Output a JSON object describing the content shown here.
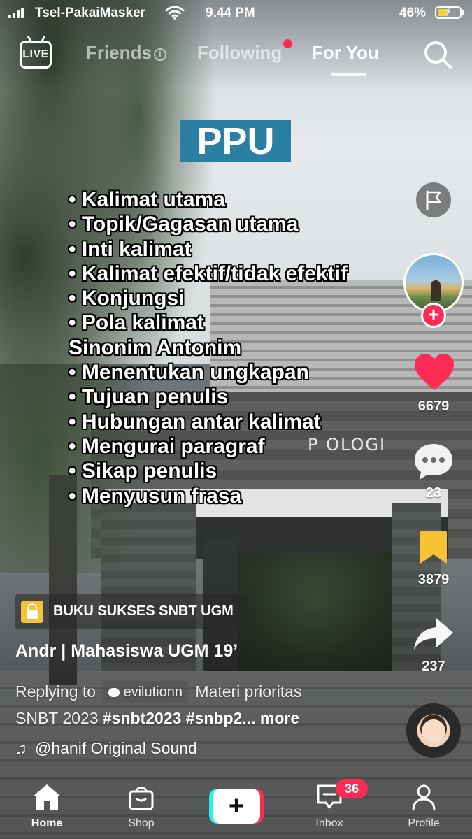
{
  "status_bar": {
    "carrier": "Tsel-PakaiMasker",
    "time": "9.44 PM",
    "battery_percent": "46%",
    "battery_level": 0.46,
    "icons": [
      "signal-icon",
      "wifi-icon",
      "battery-charging-icon"
    ]
  },
  "top_nav": {
    "live_label": "LIVE",
    "tabs": [
      {
        "label": "Friends",
        "active": false
      },
      {
        "label": "Following",
        "active": false,
        "notification_dot": true
      },
      {
        "label": "For You",
        "active": true
      }
    ],
    "search_icon": "search-icon"
  },
  "video_overlay": {
    "heading": "PPU",
    "heading_color": "#2b7fa3",
    "topics": [
      "• Kalimat utama",
      "• Topik/Gagasan utama",
      "• Inti kalimat",
      "• Kalimat efektif/tidak efektif",
      "• Konjungsi",
      "• Pola kalimat",
      "Sinonim Antonim",
      "• Menentukan ungkapan",
      "• Tujuan penulis",
      "• Hubungan antar kalimat",
      "• Mengurai paragraf",
      "• Sikap penulis",
      "• Menyusun frasa"
    ],
    "background_sign": "P  OLOGI"
  },
  "actions": {
    "likes": "6679",
    "comments": "23",
    "bookmarks": "3879",
    "shares": "237",
    "like_color": "#fe2c55",
    "bookmark_color": "#f7c234"
  },
  "post": {
    "shop_tag": "BUKU SUKSES SNBT UGM",
    "username": "Andr | Mahasiswa UGM 19’",
    "caption": {
      "reply_prefix": "Replying to",
      "reply_user": "evilutionn",
      "text_line1": "Materi prioritas",
      "text_line2_plain": "SNBT 2023 ",
      "hashtag1": "#snbt2023",
      "hashtag2": "#snbp2...",
      "more": "more"
    },
    "sound": "@hanif Original Sound"
  },
  "tab_bar": {
    "items": [
      {
        "label": "Home",
        "icon": "home-icon",
        "active": true
      },
      {
        "label": "Shop",
        "icon": "shop-bag-icon"
      },
      {
        "label": "",
        "icon": "create-plus-icon"
      },
      {
        "label": "Inbox",
        "icon": "inbox-icon",
        "badge": "36"
      },
      {
        "label": "Profile",
        "icon": "profile-icon"
      }
    ],
    "accent_red": "#fe2c55",
    "accent_cyan": "#25f4ee"
  }
}
